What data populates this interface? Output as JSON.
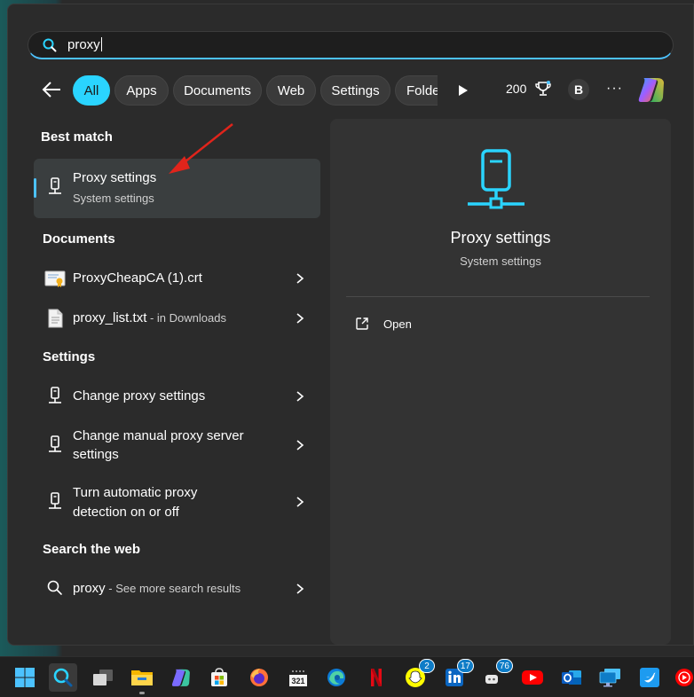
{
  "search": {
    "value": "proxy"
  },
  "filters": {
    "tabs": [
      {
        "label": "All",
        "active": true
      },
      {
        "label": "Apps"
      },
      {
        "label": "Documents"
      },
      {
        "label": "Web"
      },
      {
        "label": "Settings"
      },
      {
        "label": "Folde"
      }
    ],
    "points": "200",
    "avatar_initial": "B",
    "more": "···"
  },
  "best_match": {
    "heading": "Best match",
    "item": {
      "title": "Proxy settings",
      "subtitle": "System settings",
      "icon": "proxy-settings-icon"
    }
  },
  "documents": {
    "heading": "Documents",
    "items": [
      {
        "title": "ProxyCheapCA (1).crt",
        "suffix": "",
        "icon": "certificate-icon"
      },
      {
        "title": "proxy_list.txt",
        "suffix": " - in Downloads",
        "icon": "text-file-icon"
      }
    ]
  },
  "settings": {
    "heading": "Settings",
    "items": [
      {
        "line1": "Change proxy settings",
        "line2": ""
      },
      {
        "line1": "Change manual proxy server",
        "line2": "settings"
      },
      {
        "line1": "Turn automatic proxy",
        "line2": "detection on or off"
      }
    ]
  },
  "web": {
    "heading": "Search the web",
    "item": {
      "title": "proxy",
      "suffix": " - See more search results"
    }
  },
  "preview": {
    "title": "Proxy settings",
    "subtitle": "System settings",
    "actions": [
      {
        "label": "Open",
        "icon": "open-external-icon"
      }
    ]
  },
  "taskbar": {
    "apps": [
      {
        "name": "start",
        "icon": "windows-logo-icon"
      },
      {
        "name": "search",
        "icon": "search-icon",
        "active": true
      },
      {
        "name": "task-view",
        "icon": "task-view-icon"
      },
      {
        "name": "file-explorer",
        "icon": "folder-icon"
      },
      {
        "name": "copilot",
        "icon": "copilot-icon"
      },
      {
        "name": "store",
        "icon": "store-icon"
      },
      {
        "name": "firefox",
        "icon": "firefox-icon"
      },
      {
        "name": "calendar-app",
        "icon": "calendar-icon"
      },
      {
        "name": "edge",
        "icon": "edge-icon"
      },
      {
        "name": "netflix",
        "icon": "netflix-icon"
      },
      {
        "name": "snapchat",
        "icon": "snapchat-icon",
        "badge": "2"
      },
      {
        "name": "linkedin",
        "icon": "linkedin-icon",
        "badge": "17"
      },
      {
        "name": "discord",
        "icon": "chat-icon",
        "badge": "76"
      },
      {
        "name": "youtube",
        "icon": "youtube-icon"
      },
      {
        "name": "outlook",
        "icon": "outlook-icon"
      },
      {
        "name": "remote-desktop",
        "icon": "monitor-icon"
      },
      {
        "name": "twitter",
        "icon": "twitter-icon"
      },
      {
        "name": "youtube-music",
        "icon": "music-icon"
      }
    ]
  },
  "colors": {
    "accent": "#4cc2ff",
    "active_pill": "#2ad4ff",
    "annotation_arrow": "#e0241b"
  }
}
